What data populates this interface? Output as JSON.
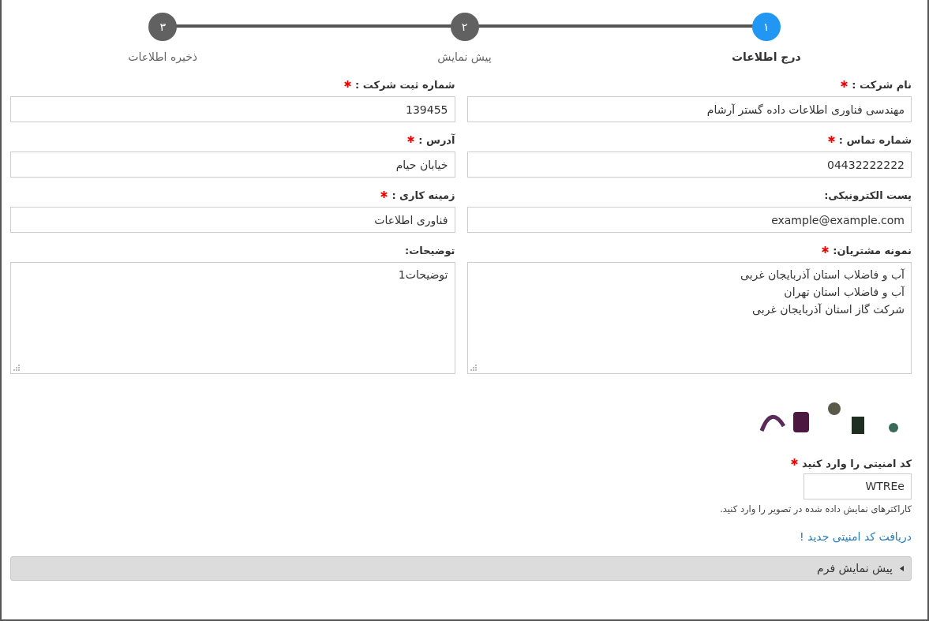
{
  "steps": [
    {
      "number": "١",
      "label": "درج اطلاعات",
      "selected": true
    },
    {
      "number": "٢",
      "label": "پیش نمایش",
      "selected": false
    },
    {
      "number": "٣",
      "label": "ذخیره اطلاعات",
      "selected": false
    }
  ],
  "fields": [
    {
      "kind": "input",
      "label": "نام شرکت :",
      "required": true,
      "value": "مهندسی فناوری اطلاعات داده گستر آرشام"
    },
    {
      "kind": "input",
      "label": "شماره ثبت شرکت :",
      "required": true,
      "value": "139455"
    },
    {
      "kind": "input",
      "label": "شماره تماس :",
      "required": true,
      "value": "04432222222"
    },
    {
      "kind": "input",
      "label": "آدرس :",
      "required": true,
      "value": "خیابان حیام"
    },
    {
      "kind": "input",
      "label": "پست الکترونیکی:",
      "required": false,
      "value": "example@example.com"
    },
    {
      "kind": "input",
      "label": "زمینه کاری :",
      "required": true,
      "value": "فناوری اطلاعات"
    },
    {
      "kind": "textarea",
      "label": "نمونه مشتریان:",
      "required": true,
      "value": "آب و فاضلاب استان آذربایجان غربی\nآب و فاضلاب استان تهران\nشرکت گاز استان آذربایجان غربی"
    },
    {
      "kind": "textarea",
      "label": "توضیحات:",
      "required": false,
      "value": "توضیحات1"
    }
  ],
  "captcha": {
    "label": "کد امنیتی را وارد کنید",
    "required": true,
    "value": "WTREe",
    "help": "کاراکترهای نمایش داده شده در تصویر را وارد کنید."
  },
  "new_code_link": "دریافت کد امنیتی جدید !",
  "preview_panel": {
    "label": "پیش نمایش فرم",
    "expanded": false
  }
}
